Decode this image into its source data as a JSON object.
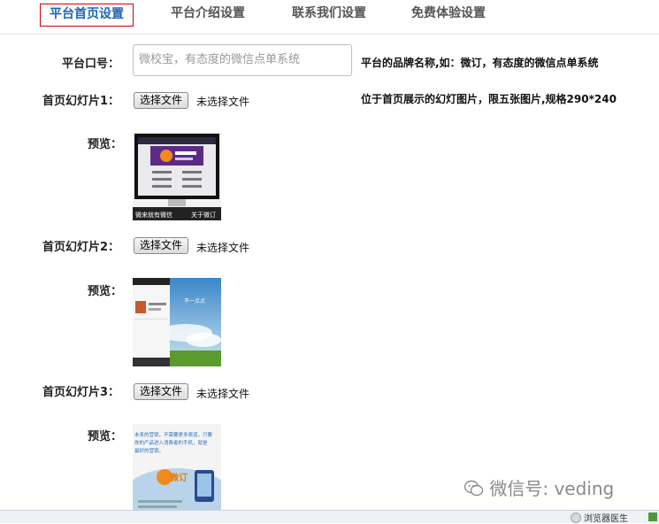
{
  "tabs": [
    {
      "label": "平台首页设置",
      "active": true
    },
    {
      "label": "平台介绍设置",
      "active": false
    },
    {
      "label": "联系我们设置",
      "active": false
    },
    {
      "label": "免费体验设置",
      "active": false
    }
  ],
  "slogan": {
    "label": "平台口号：",
    "value": "微校宝，有态度的微信点单系统",
    "hint": "平台的品牌名称,如：微订，有态度的微信点单系统"
  },
  "slides": [
    {
      "label": "首页幻灯片1：",
      "button": "选择文件",
      "status": "未选择文件",
      "hint": "位于首页展示的幻灯图片，限五张图片,规格290*240",
      "preview_label": "预览："
    },
    {
      "label": "首页幻灯片2：",
      "button": "选择文件",
      "status": "未选择文件",
      "preview_label": "预览："
    },
    {
      "label": "首页幻灯片3：",
      "button": "选择文件",
      "status": "未选择文件",
      "preview_label": "预览："
    }
  ],
  "previews": {
    "slide1_text_left": "微来就有微信",
    "slide1_text_right": "关于微订",
    "slide2_text": "不一点点",
    "slide3_lines": [
      "未来的营销，不需要更多渠道，只要",
      "你的产品进入消费者的手机，就是",
      "最好的营销。"
    ],
    "slide3_logo": "微订"
  },
  "watermark": "微信号: veding",
  "statusbar": {
    "text": "浏览器医生"
  },
  "colors": {
    "active_tab": "#1e66b8",
    "active_border": "#d40000"
  }
}
